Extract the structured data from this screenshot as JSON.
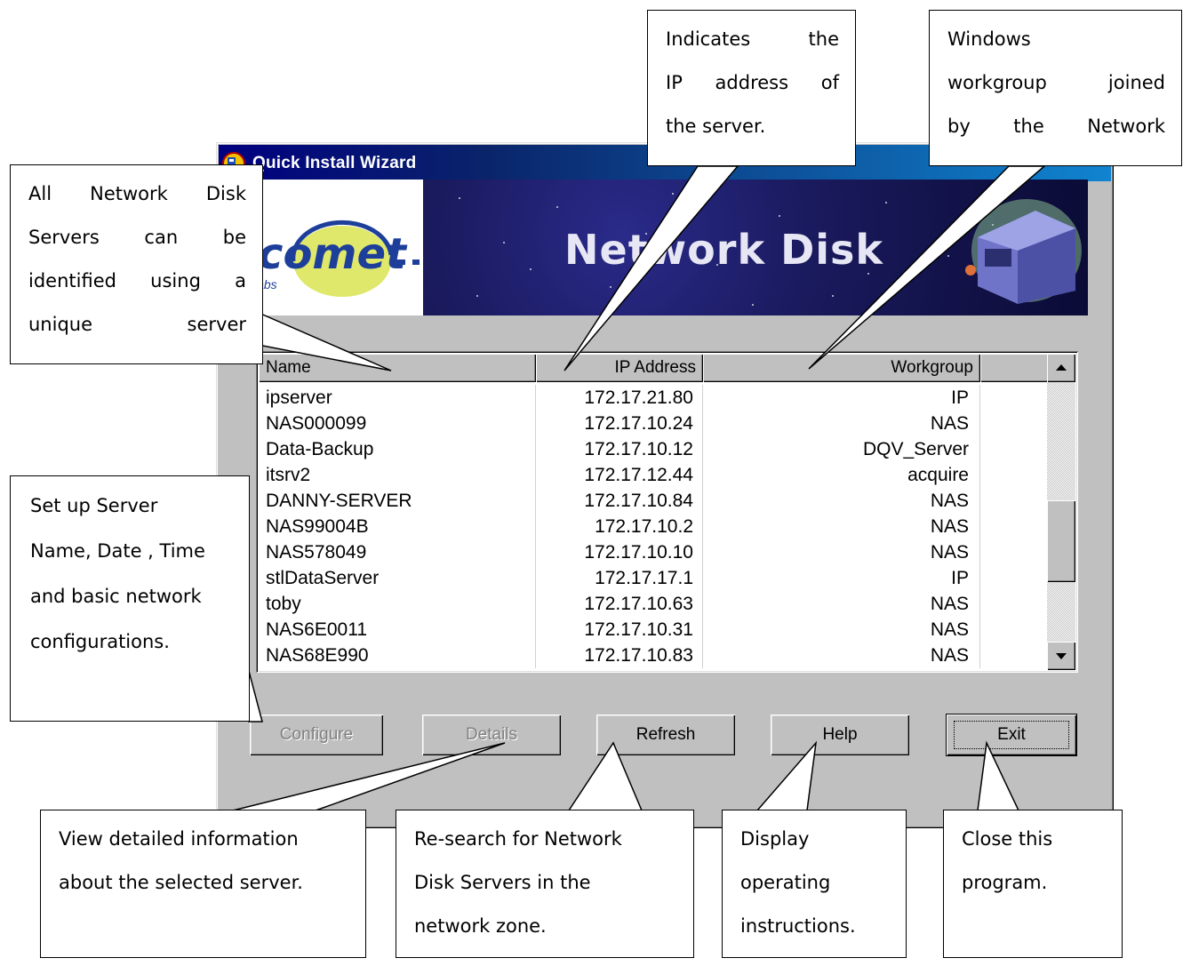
{
  "window": {
    "title": "Quick Install Wizard",
    "banner_title": "Network Disk",
    "logo_text": "comet",
    "logo_sub": "labs"
  },
  "list": {
    "columns": [
      "Name",
      "IP Address",
      "Workgroup"
    ],
    "rows": [
      {
        "name": "ipserver",
        "ip": "172.17.21.80",
        "workgroup": "IP"
      },
      {
        "name": "NAS000099",
        "ip": "172.17.10.24",
        "workgroup": "NAS"
      },
      {
        "name": "Data-Backup",
        "ip": "172.17.10.12",
        "workgroup": "DQV_Server"
      },
      {
        "name": "itsrv2",
        "ip": "172.17.12.44",
        "workgroup": "acquire"
      },
      {
        "name": "DANNY-SERVER",
        "ip": "172.17.10.84",
        "workgroup": "NAS"
      },
      {
        "name": "NAS99004B",
        "ip": "172.17.10.2",
        "workgroup": "NAS"
      },
      {
        "name": "NAS578049",
        "ip": "172.17.10.10",
        "workgroup": "NAS"
      },
      {
        "name": "stlDataServer",
        "ip": "172.17.17.1",
        "workgroup": "IP"
      },
      {
        "name": "toby",
        "ip": "172.17.10.63",
        "workgroup": "NAS"
      },
      {
        "name": "NAS6E0011",
        "ip": "172.17.10.31",
        "workgroup": "NAS"
      },
      {
        "name": "NAS68E990",
        "ip": "172.17.10.83",
        "workgroup": "NAS"
      }
    ]
  },
  "buttons": {
    "configure": "Configure",
    "details": "Details",
    "refresh": "Refresh",
    "help": "Help",
    "exit": "Exit"
  },
  "callouts": {
    "ip": [
      "Indicates the",
      "IP address of",
      "the server."
    ],
    "workgroup": [
      "Windows",
      "workgroup joined",
      "by the Network"
    ],
    "name": [
      "All Network Disk",
      "Servers can be",
      "identified using a",
      "unique server"
    ],
    "configure": [
      "Set up Server",
      "Name, Date , Time",
      "and basic network",
      "configurations."
    ],
    "details": [
      "View detailed information",
      "about the selected server."
    ],
    "refresh": [
      "Re-search for Network",
      "Disk Servers in the",
      "network zone."
    ],
    "help": [
      "Display",
      "operating",
      "instructions."
    ],
    "exit": [
      "Close this",
      "program."
    ]
  },
  "icons": {
    "app": "app-icon",
    "scroll_up": "scroll-up-arrow-icon",
    "scroll_down": "scroll-down-arrow-icon",
    "server": "nas-server-icon"
  }
}
